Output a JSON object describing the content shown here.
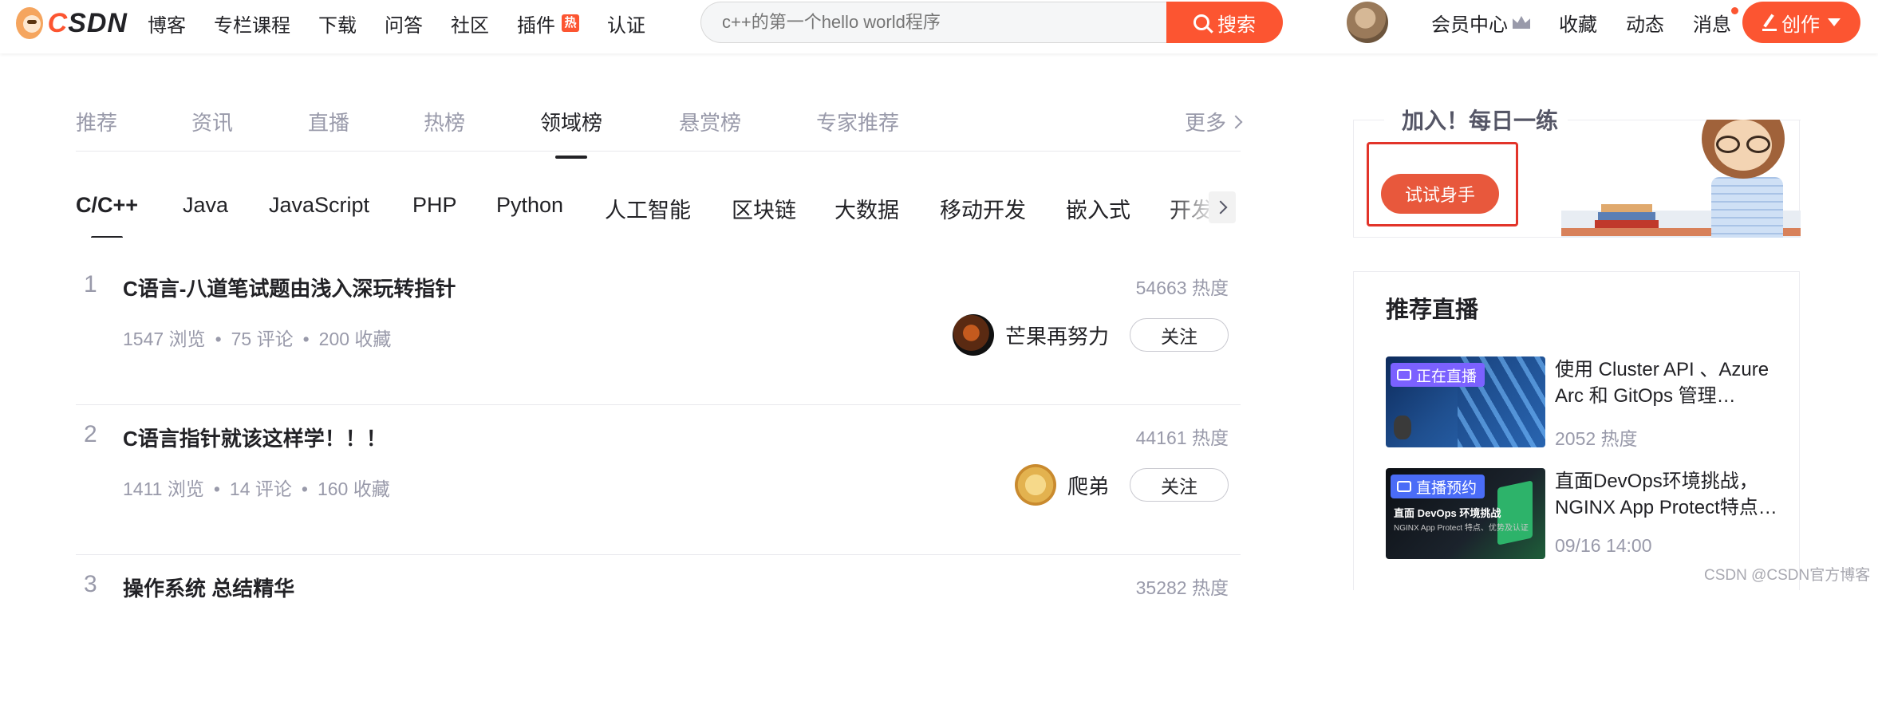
{
  "header": {
    "logo_text": "CSDN",
    "nav": [
      "博客",
      "专栏课程",
      "下载",
      "问答",
      "社区",
      "插件",
      "认证"
    ],
    "plugin_badge": "热",
    "search_placeholder": "c++的第一个hello world程序",
    "search_button": "搜索",
    "right_nav": {
      "vip": "会员中心",
      "favorites": "收藏",
      "activity": "动态",
      "messages": "消息"
    },
    "create_button": "创作"
  },
  "tabs": {
    "items": [
      "推荐",
      "资讯",
      "直播",
      "热榜",
      "领域榜",
      "悬赏榜",
      "专家推荐"
    ],
    "active": "领域榜",
    "more": "更多"
  },
  "categories": {
    "items": [
      "C/C++",
      "Java",
      "JavaScript",
      "PHP",
      "Python",
      "人工智能",
      "区块链",
      "大数据",
      "移动开发",
      "嵌入式",
      "开发"
    ],
    "active": "C/C++"
  },
  "ranking": [
    {
      "rank": "1",
      "title": "C语言-八道笔试题由浅入深玩转指针",
      "views": "1547 浏览",
      "comments": "75 评论",
      "favorites": "200 收藏",
      "heat": "54663 热度",
      "author": "芒果再努力",
      "follow": "关注"
    },
    {
      "rank": "2",
      "title": "C语言指针就该这样学！！！",
      "views": "1411 浏览",
      "comments": "14 评论",
      "favorites": "160 收藏",
      "heat": "44161 热度",
      "author": "爬弟",
      "follow": "关注"
    },
    {
      "rank": "3",
      "title": "操作系统 总结精华",
      "views": "",
      "comments": "",
      "favorites": "",
      "heat": "35282 热度",
      "author": "",
      "follow": ""
    }
  ],
  "meta_sep": "•",
  "practice": {
    "title": "加入！每日一练",
    "button": "试试身手"
  },
  "live": {
    "title": "推荐直播",
    "items": [
      {
        "badge": "正在直播",
        "badge_color": "#7b61ff",
        "text": "使用 Cluster API 、Azure Arc 和 GitOps 管理…",
        "sub": "2052 热度"
      },
      {
        "badge": "直播预约",
        "badge_color": "#4a6cf7",
        "text": "直面DevOps环境挑战，NGINX App Protect特点…",
        "sub": "09/16 14:00",
        "thumb_title": "直面 DevOps 环境挑战",
        "thumb_sub": "NGINX App Protect 特点、优势及认证"
      }
    ]
  },
  "watermark": "CSDN @CSDN官方博客",
  "colors": {
    "brand": "#fc5531",
    "text": "#222226",
    "muted": "#999aaa"
  }
}
